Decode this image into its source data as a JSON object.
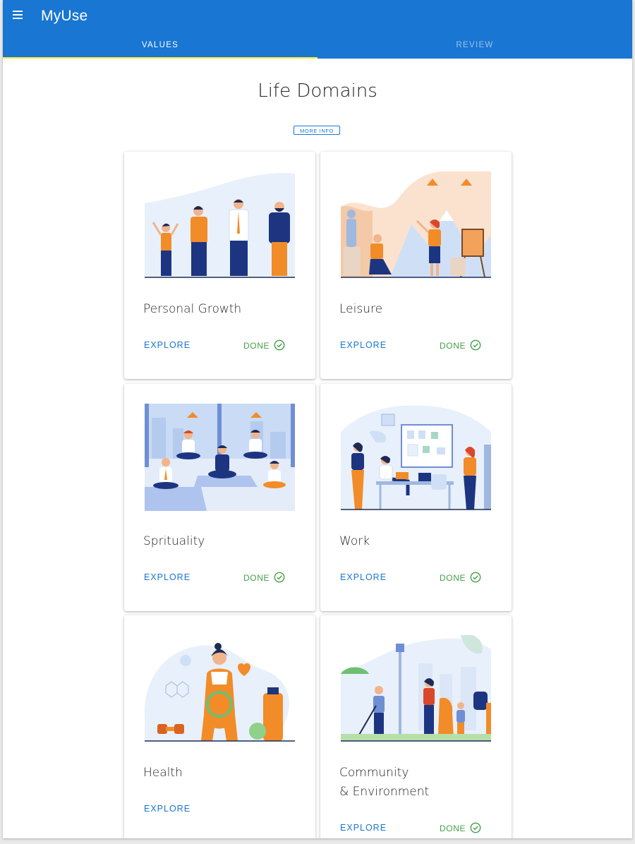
{
  "app": {
    "title": "MyUse"
  },
  "tabs": [
    {
      "label": "VALUES",
      "active": true
    },
    {
      "label": "REVIEW",
      "active": false
    }
  ],
  "page": {
    "title": "Life Domains",
    "more_info": "MORE INFO"
  },
  "colors": {
    "primary": "#1976d2",
    "tab_indicator": "#ffeb3b",
    "done_green": "#43a047"
  },
  "cards": [
    {
      "title": "Personal Growth",
      "explore": "EXPLORE",
      "done": "DONE",
      "illustration": "group-of-people-illustration"
    },
    {
      "title": "Leisure",
      "explore": "EXPLORE",
      "done": "DONE",
      "illustration": "artists-painting-illustration"
    },
    {
      "title": "Sprituality",
      "explore": "EXPLORE",
      "done": "DONE",
      "illustration": "meditation-class-illustration"
    },
    {
      "title": "Work",
      "explore": "EXPLORE",
      "done": "DONE",
      "illustration": "office-meeting-illustration"
    },
    {
      "title": "Health",
      "explore": "EXPLORE",
      "illustration": "healthy-woman-illustration"
    },
    {
      "title": "Community\n& Environment",
      "title_line1": "Community",
      "title_line2": "& Environment",
      "explore": "EXPLORE",
      "done": "DONE",
      "illustration": "park-cleanup-illustration"
    }
  ]
}
